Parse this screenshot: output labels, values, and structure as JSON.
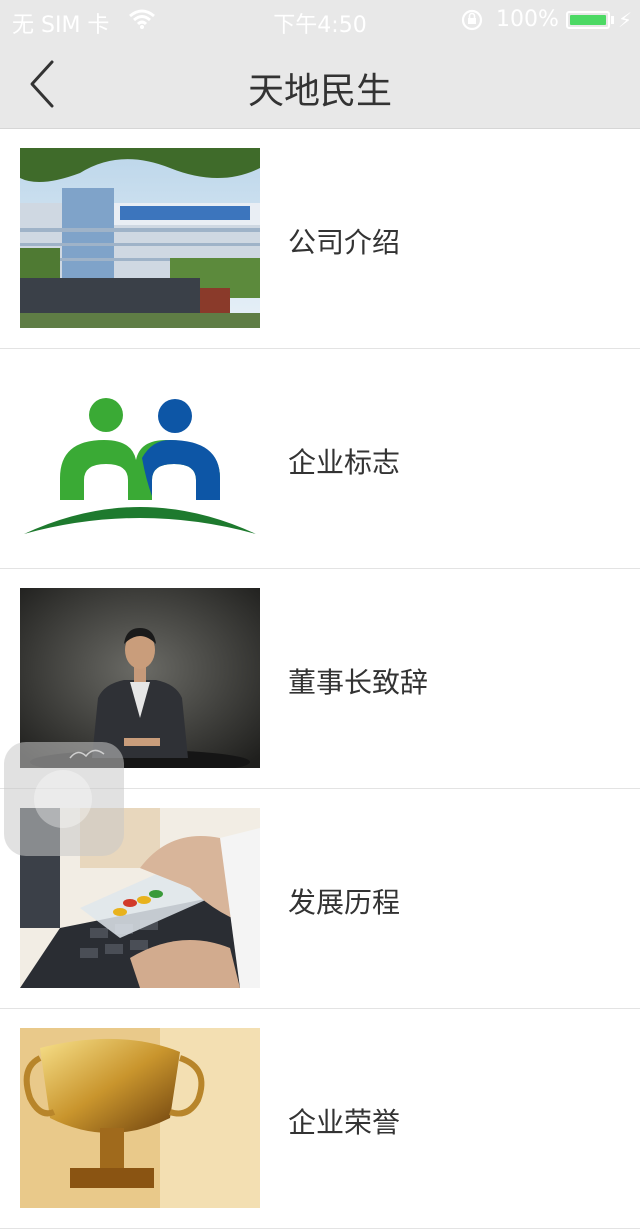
{
  "status_bar": {
    "carrier": "无 SIM 卡",
    "time": "下午4:50",
    "battery": "100%",
    "battery_level": 1.0,
    "icons": [
      "wifi-icon",
      "rotation-lock-icon",
      "battery-icon",
      "charging-icon"
    ]
  },
  "nav": {
    "title": "天地民生",
    "back_icon": "chevron-left-icon"
  },
  "list": {
    "items": [
      {
        "label": "公司介绍",
        "thumb": "company-building-photo"
      },
      {
        "label": "企业标志",
        "thumb": "company-logo"
      },
      {
        "label": "董事长致辞",
        "thumb": "chairman-portrait"
      },
      {
        "label": "发展历程",
        "thumb": "hand-with-pills-photo"
      },
      {
        "label": "企业荣誉",
        "thumb": "trophy-photo"
      }
    ]
  },
  "colors": {
    "bar_bg": "#e8e8e8",
    "logo_green": "#3aaa35",
    "logo_blue": "#0d56a6",
    "logo_dark_green": "#1e7a2e",
    "battery_green": "#4cd964"
  }
}
